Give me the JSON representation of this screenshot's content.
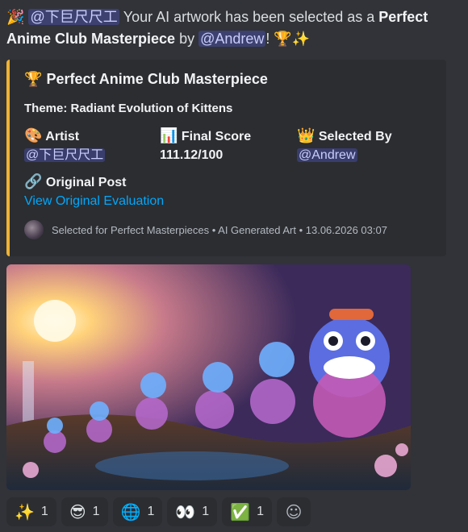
{
  "message": {
    "lead_emoji": "🎉",
    "mention_artist": "@下巨尺尺工",
    "text_1": " Your AI artwork has been selected as a ",
    "highlight": "Perfect Anime Club Masterpiece",
    "text_2": " by ",
    "mention_selector": "@Andrew",
    "text_3": "!",
    "trail_emoji": "🏆✨"
  },
  "embed": {
    "accent_color": "#f0b232",
    "title_emoji": "🏆",
    "title": "Perfect Anime Club Masterpiece",
    "theme": "Theme: Radiant Evolution of Kittens",
    "fields": {
      "artist_icon": "🎨",
      "artist_label": "Artist",
      "artist_value": "@下巨尺尺工",
      "score_icon": "📊",
      "score_label": "Final Score",
      "score_value": "111.12/100",
      "selected_icon": "👑",
      "selected_label": "Selected By",
      "selected_value": "@Andrew"
    },
    "original_post_icon": "🔗",
    "original_post_label": "Original Post",
    "original_post_link": "View Original Evaluation",
    "footer": "Selected for Perfect Masterpieces • AI Generated Art • 13.06.2026 03:07"
  },
  "reactions": [
    {
      "emoji": "✨",
      "count": "1"
    },
    {
      "emoji": "😎",
      "count": "1"
    },
    {
      "emoji": "🌐",
      "count": "1"
    },
    {
      "emoji": "👀",
      "count": "1"
    },
    {
      "emoji": "✅",
      "count": "1"
    }
  ],
  "add_reaction_icon": "☺"
}
